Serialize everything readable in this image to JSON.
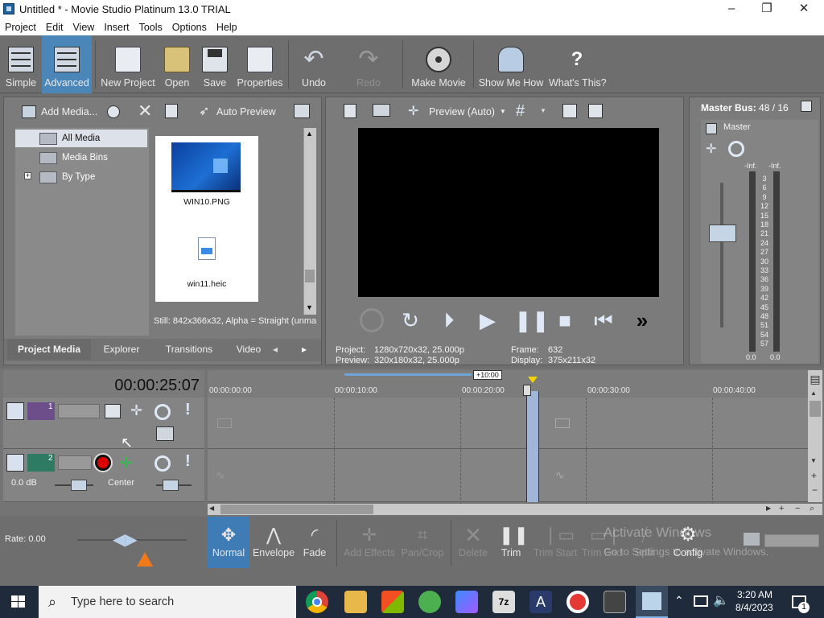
{
  "window": {
    "title": "Untitled * - Movie Studio Platinum 13.0 TRIAL",
    "minimize": "–",
    "maximize": "❐",
    "close": "✕"
  },
  "menu": [
    "Project",
    "Edit",
    "View",
    "Insert",
    "Tools",
    "Options",
    "Help"
  ],
  "toolbar": {
    "simple": "Simple",
    "advanced": "Advanced",
    "new_project": "New Project",
    "open": "Open",
    "save": "Save",
    "properties": "Properties",
    "undo": "Undo",
    "redo": "Redo",
    "make_movie": "Make Movie",
    "show_me_how": "Show Me How",
    "whats_this": "What's This?"
  },
  "media_panel": {
    "add_media": "Add Media...",
    "auto_preview": "Auto Preview",
    "tree": [
      "All Media",
      "Media Bins",
      "By Type"
    ],
    "files": [
      "WIN10.PNG",
      "win11.heic"
    ],
    "status": "Still: 842x366x32, Alpha = Straight (unma",
    "tabs": [
      "Project Media",
      "Explorer",
      "Transitions",
      "Video"
    ]
  },
  "preview_panel": {
    "mode": "Preview (Auto)",
    "project_label": "Project:",
    "project_value": "1280x720x32, 25.000p",
    "preview_label": "Preview:",
    "preview_value": "320x180x32, 25.000p",
    "frame_label": "Frame:",
    "frame_value": "632",
    "display_label": "Display:",
    "display_value": "375x211x32"
  },
  "mixer": {
    "title": "Master Bus:",
    "title_value": "48 / 16",
    "master": "Master",
    "inf_left": "-Inf.",
    "inf_right": "-Inf.",
    "scale": [
      "3",
      "6",
      "9",
      "12",
      "15",
      "18",
      "21",
      "24",
      "27",
      "30",
      "33",
      "36",
      "39",
      "42",
      "45",
      "48",
      "51",
      "54",
      "57"
    ],
    "bottom_left": "0.0",
    "bottom_right": "0.0"
  },
  "timeline": {
    "timecode": "00:00:25:07",
    "zoom_label": "+10:00",
    "ruler": [
      "00:00:00:00",
      "00:00:10:00",
      "00:00:20:00",
      "00:00:30:00",
      "00:00:40:00"
    ],
    "track1_num": "1",
    "track2_num": "2",
    "volume": "0.0 dB",
    "pan": "Center"
  },
  "bottom_tools": {
    "rate": "Rate: 0.00",
    "normal": "Normal",
    "envelope": "Envelope",
    "fade": "Fade",
    "add_effects": "Add Effects",
    "pan_crop": "Pan/Crop",
    "delete": "Delete",
    "trim": "Trim",
    "trim_start": "Trim Start",
    "trim_end": "Trim End",
    "split": "Split",
    "config": "Config",
    "watermark1": "Activate Windows",
    "watermark2": "Go to Settings to activate Windows."
  },
  "taskbar": {
    "search_placeholder": "Type here to search",
    "time": "3:20 AM",
    "date": "8/4/2023",
    "notif_count": "1"
  }
}
